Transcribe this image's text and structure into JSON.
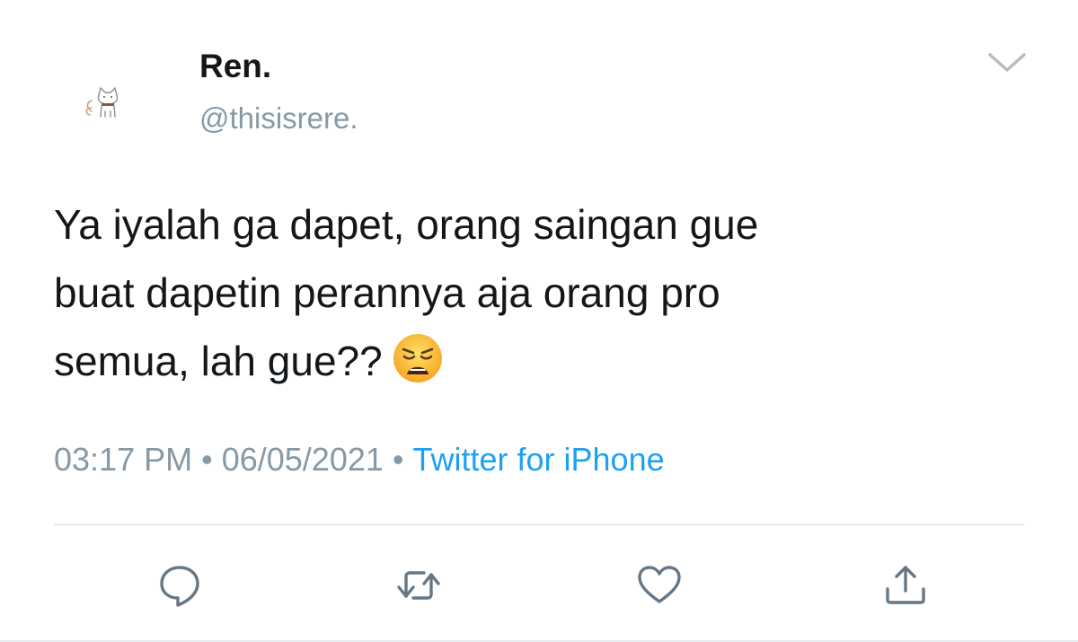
{
  "author": {
    "display_name": "Ren.",
    "handle": "@thisisrere."
  },
  "tweet": {
    "text_lines": [
      "Ya iyalah ga dapet, orang saingan gue",
      "buat dapetin perannya aja orang pro",
      "semua, lah gue??"
    ],
    "emoji": "weary-face"
  },
  "meta": {
    "time": "03:17 PM",
    "separator": "•",
    "date": "06/05/2021",
    "source": "Twitter for iPhone"
  },
  "actions": {
    "reply_icon": "speech-bubble-icon",
    "retweet_icon": "retweet-arrows-icon",
    "like_icon": "heart-icon",
    "share_icon": "share-upload-icon"
  },
  "colors": {
    "text": "#14171a",
    "secondary": "#8899a6",
    "link": "#1da1f2",
    "icon": "#657786"
  }
}
